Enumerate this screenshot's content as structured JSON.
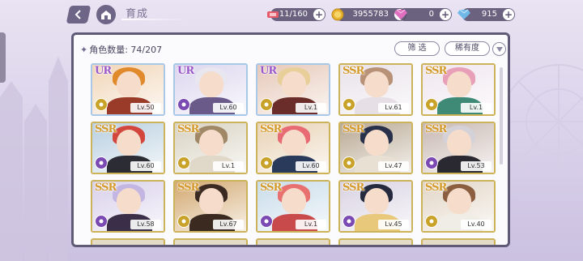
{
  "header": {
    "title": "育成",
    "resources": [
      {
        "name": "stamina",
        "icon": "candy-ticket-icon",
        "value": "11/160",
        "color": "#e45a6a"
      },
      {
        "name": "gold",
        "icon": "gold-coin-icon",
        "value": "3955783",
        "color": "#e8b230"
      },
      {
        "name": "pink-gem",
        "icon": "pink-diamond-icon",
        "value": "0",
        "color": "#e06fc0"
      },
      {
        "name": "blue-gem",
        "icon": "blue-diamond-icon",
        "value": "915",
        "color": "#6fb8e8"
      }
    ]
  },
  "panel": {
    "count_label": "角色数量: 74/207",
    "filter_label": "筛 选",
    "rarity_label": "稀有度"
  },
  "cards": [
    {
      "rarity": "UR",
      "level": "Lv.50",
      "attr_color": "#c9a22a",
      "hair": "#e08a2c",
      "bg": "#f1d6b8",
      "outfit": "#9a3b2a"
    },
    {
      "rarity": "UR",
      "level": "Lv.60",
      "attr_color": "#7b4bb3",
      "hair": "#e8e6ef",
      "bg": "#dcd6ee",
      "outfit": "#6a5a8a"
    },
    {
      "rarity": "UR",
      "level": "Lv.1",
      "attr_color": "#c9a22a",
      "hair": "#e8cf9a",
      "bg": "#e6c8b8",
      "outfit": "#6b2d2a"
    },
    {
      "rarity": "SSR",
      "level": "Lv.61",
      "attr_color": "#c9a22a",
      "hair": "#b89278",
      "bg": "#e8e2ea",
      "outfit": "#e6e0e6"
    },
    {
      "rarity": "SSR",
      "level": "Lv.1",
      "attr_color": "#c9a22a",
      "hair": "#e7a0b8",
      "bg": "#efe6ee",
      "outfit": "#3e8a76"
    },
    {
      "rarity": "SSR",
      "level": "Lv.60",
      "attr_color": "#7b4bb3",
      "hair": "#d2463e",
      "bg": "#b8cfe0",
      "outfit": "#2c2c34"
    },
    {
      "rarity": "SSR",
      "level": "Lv.1",
      "attr_color": "#c9a22a",
      "hair": "#a08866",
      "bg": "#d8d2c2",
      "outfit": "#e0d8c8"
    },
    {
      "rarity": "SSR",
      "level": "Lv.60",
      "attr_color": "#c9a22a",
      "hair": "#e86a72",
      "bg": "#e8d2b4",
      "outfit": "#2a3a5a"
    },
    {
      "rarity": "SSR",
      "level": "Lv.47",
      "attr_color": "#c9a22a",
      "hair": "#28304a",
      "bg": "#b8a892",
      "outfit": "#e8e0d2"
    },
    {
      "rarity": "SSR",
      "level": "Lv.53",
      "attr_color": "#7b4bb3",
      "hair": "#d4d2d8",
      "bg": "#c8b8b2",
      "outfit": "#2a2830"
    },
    {
      "rarity": "SSR",
      "level": "Lv.58",
      "attr_color": "#7b4bb3",
      "hair": "#c4b6e2",
      "bg": "#d8d0ea",
      "outfit": "#3a2e48"
    },
    {
      "rarity": "SSR",
      "level": "Lv.67",
      "attr_color": "#c9a22a",
      "hair": "#3a2a22",
      "bg": "#d2a870",
      "outfit": "#3a2a20"
    },
    {
      "rarity": "SSR",
      "level": "Lv.1",
      "attr_color": "#7b4bb3",
      "hair": "#e8706e",
      "bg": "#c8dcea",
      "outfit": "#c84a4a"
    },
    {
      "rarity": "SSR",
      "level": "Lv.45",
      "attr_color": "#7b4bb3",
      "hair": "#262a3e",
      "bg": "#d8d2e2",
      "outfit": "#e8c87a"
    },
    {
      "rarity": "SSR",
      "level": "Lv.40",
      "attr_color": "#c9a22a",
      "hair": "#8a5e3e",
      "bg": "#e2d6c6",
      "outfit": "#f0ece6"
    }
  ]
}
